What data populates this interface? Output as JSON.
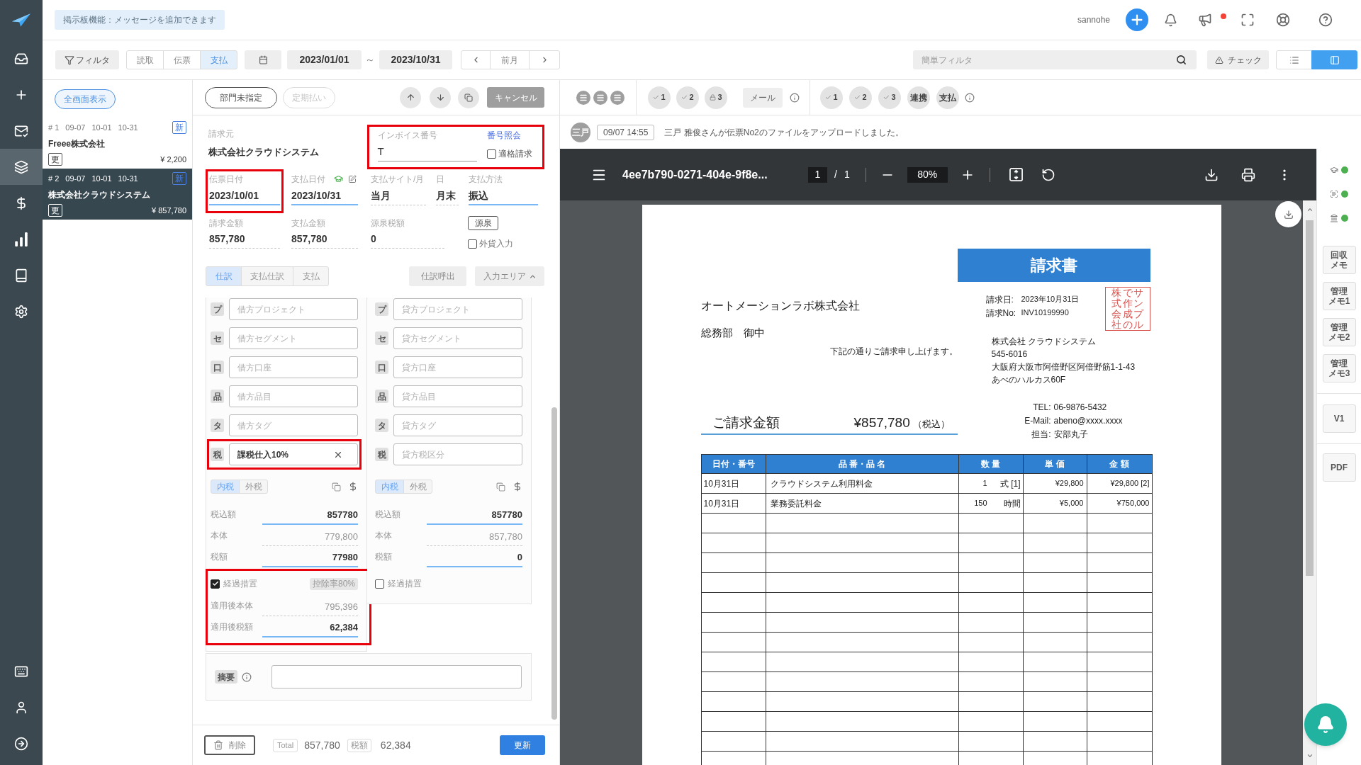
{
  "nav": {
    "items": [
      {
        "kind": "inbox",
        "selected": false
      },
      {
        "kind": "add",
        "selected": false
      },
      {
        "kind": "mail",
        "selected": false
      },
      {
        "kind": "layers",
        "selected": true
      },
      {
        "kind": "dollar",
        "selected": false
      },
      {
        "kind": "chart",
        "selected": false
      },
      {
        "kind": "book",
        "selected": false
      },
      {
        "kind": "settings",
        "selected": false
      }
    ],
    "bottom_items": [
      {
        "kind": "keyboard",
        "selected": false
      },
      {
        "kind": "user",
        "selected": false
      },
      {
        "kind": "logout",
        "selected": false
      }
    ]
  },
  "header": {
    "bulletin": "掲示板機能：メッセージを追加できます",
    "user": "sannohe",
    "announcements_unread": true
  },
  "filter_bar": {
    "filter_label": "フィルタ",
    "modes": [
      {
        "label": "読取",
        "selected": false
      },
      {
        "label": "伝票",
        "selected": false
      },
      {
        "label": "支払",
        "selected": true
      }
    ],
    "date_from": "2023/01/01",
    "range_separator": "～",
    "date_to": "2023/10/31",
    "prev_month": "前月",
    "search": {
      "placeholder": "簡単フィルタ"
    },
    "check_label": "チェック",
    "views": [
      {
        "kind": "list",
        "selected": false
      },
      {
        "kind": "split",
        "selected": true
      }
    ]
  },
  "list": {
    "fullscreen_label": "全画面表示",
    "items": [
      {
        "number": "# 1",
        "dates": [
          "09-07",
          "10-01",
          "10-31"
        ],
        "new_badge": "新",
        "vendor": "Freee株式会社",
        "update_badge": "更",
        "amount": "¥ 2,200",
        "selected": false
      },
      {
        "number": "# 2",
        "dates": [
          "09-07",
          "10-01",
          "10-31"
        ],
        "new_badge": "新",
        "vendor": "株式会社クラウドシステム",
        "update_badge": "更",
        "amount": "¥ 857,780",
        "selected": true
      }
    ]
  },
  "form": {
    "toolbar": {
      "department": "部門未指定",
      "recurring": {
        "label": "定期払い",
        "disabled": true
      },
      "cancel": "キャンセル"
    },
    "vendor": {
      "label": "請求元",
      "value": "株式会社クラウドシステム"
    },
    "invoice": {
      "label": "インボイス番号",
      "value": "T",
      "lookup": "番号照会",
      "qualified": {
        "label": "適格請求",
        "checked": false
      },
      "highlighted": true
    },
    "dates": [
      {
        "label": "伝票日付",
        "value": "2023/10/01",
        "kind": "input",
        "highlighted": true
      },
      {
        "label": "支払日付",
        "value": "2023/10/31",
        "kind": "input",
        "highlighted": false,
        "tools": true
      },
      {
        "label": "支払サイト/月",
        "value": "当月",
        "kind": "readonly",
        "highlighted": false
      },
      {
        "label": "日",
        "value": "月末",
        "kind": "readonly",
        "highlighted": false
      },
      {
        "label": "支払方法",
        "value": "振込",
        "kind": "input",
        "highlighted": false
      }
    ],
    "amounts": [
      {
        "label": "請求金額",
        "value": "857,780",
        "kind": "readonly"
      },
      {
        "label": "支払金額",
        "value": "857,780",
        "kind": "readonly"
      },
      {
        "label": "源泉税額",
        "value": "0",
        "kind": "readonly"
      }
    ],
    "withholding_button": "源泉",
    "foreign_currency": {
      "label": "外貨入力",
      "checked": false
    },
    "tabs": [
      {
        "label": "仕訳",
        "selected": true
      },
      {
        "label": "支払仕訳",
        "selected": false
      },
      {
        "label": "支払",
        "selected": false
      }
    ],
    "recall": "仕訳呼出",
    "input_area": "入力エリア",
    "columns": [
      {
        "fields": [
          {
            "tag": "プ",
            "placeholder": "借方プロジェクト",
            "highlighted": false
          },
          {
            "tag": "セ",
            "placeholder": "借方セグメント",
            "highlighted": false
          },
          {
            "tag": "口",
            "placeholder": "借方口座",
            "highlighted": false
          },
          {
            "tag": "品",
            "placeholder": "借方品目",
            "highlighted": false
          },
          {
            "tag": "タ",
            "placeholder": "借方タグ",
            "highlighted": false
          },
          {
            "tag": "税",
            "value": "課税仕入10%",
            "highlighted": true
          }
        ],
        "tax_modes": [
          {
            "label": "内税",
            "selected": true
          },
          {
            "label": "外税",
            "selected": false
          }
        ],
        "amounts": [
          {
            "label": "税込額",
            "value": "857780",
            "kind": "input"
          },
          {
            "label": "本体",
            "value": "779,800",
            "kind": "readonly"
          },
          {
            "label": "税額",
            "value": "77980",
            "kind": "input"
          }
        ],
        "transition": {
          "label": "経過措置",
          "checked": true,
          "rate": "控除率80%",
          "rows": [
            {
              "label": "適用後本体",
              "value": "795,396",
              "kind": "readonly"
            },
            {
              "label": "適用後税額",
              "value": "62,384",
              "kind": "input"
            }
          ],
          "highlighted": true
        }
      },
      {
        "fields": [
          {
            "tag": "プ",
            "placeholder": "貸方プロジェクト",
            "highlighted": false
          },
          {
            "tag": "セ",
            "placeholder": "貸方セグメント",
            "highlighted": false
          },
          {
            "tag": "口",
            "placeholder": "貸方口座",
            "highlighted": false
          },
          {
            "tag": "品",
            "placeholder": "貸方品目",
            "highlighted": false
          },
          {
            "tag": "タ",
            "placeholder": "貸方タグ",
            "highlighted": false
          },
          {
            "tag": "税",
            "placeholder": "貸方税区分",
            "highlighted": false
          }
        ],
        "tax_modes": [
          {
            "label": "内税",
            "selected": true
          },
          {
            "label": "外税",
            "selected": false
          }
        ],
        "amounts": [
          {
            "label": "税込額",
            "value": "857780",
            "kind": "input"
          },
          {
            "label": "本体",
            "value": "857,780",
            "kind": "readonly"
          },
          {
            "label": "税額",
            "value": "0",
            "kind": "input"
          }
        ],
        "transition": {
          "label": "経過措置",
          "checked": false,
          "highlighted": false
        }
      }
    ],
    "memo": {
      "tag": "摘要"
    },
    "footer": {
      "delete": "削除",
      "total_label": "Total",
      "total": "857,780",
      "tax_label": "税額",
      "tax": "62,384",
      "update": "更新"
    }
  },
  "toolbar": {
    "approvals": [
      {
        "kind": "check",
        "label": "1"
      },
      {
        "kind": "check",
        "label": "2"
      },
      {
        "kind": "lock",
        "label": "3"
      }
    ],
    "mail": "メール",
    "stages": [
      {
        "kind": "check",
        "label": "1"
      },
      {
        "kind": "check",
        "label": "2"
      },
      {
        "kind": "check",
        "label": "3"
      },
      {
        "kind": "text",
        "label": "連携"
      },
      {
        "kind": "text",
        "label": "支払"
      }
    ]
  },
  "activity": {
    "avatar": "三戸",
    "time": "09/07 14:55",
    "message": "三戸 雅俊さんが伝票No2のファイルをアップロードしました。"
  },
  "viewer": {
    "filename": "4ee7b790-0271-404e-9f8e...",
    "page": "1",
    "page_separator": "/",
    "page_count": "1",
    "zoom": "80%"
  },
  "document": {
    "title": "請求書",
    "recipient": "オートメーションラボ株式会社",
    "department": "総務部　御中",
    "note": "下記の通りご請求申し上げます。",
    "meta": [
      {
        "label": "請求日:",
        "value": "2023年10月31日"
      },
      {
        "label": "請求No:",
        "value": "INV10199990"
      }
    ],
    "stamp": [
      "株式会社",
      "で作成の",
      "サンプル"
    ],
    "issuer": [
      "株式会社 クラウドシステム",
      "545-6016",
      "大阪府大阪市阿倍野区阿倍野筋1-1-43",
      "あべのハルカス60F"
    ],
    "contact": [
      {
        "label": "TEL:",
        "value": "06-9876-5432"
      },
      {
        "label": "E-Mail:",
        "value": "abeno@xxxx.xxxx"
      },
      {
        "label": "担当:",
        "value": "安部丸子"
      }
    ],
    "total_label": "ご請求金額",
    "total": "¥857,780",
    "total_note": "（税込）",
    "table": {
      "columns": [
        "日付・番号",
        "品 番・品 名",
        "数 量",
        "単 価",
        "金 額"
      ],
      "rows": [
        {
          "date": "10月31日",
          "item": "クラウドシステム利用料金",
          "quantity": "1",
          "unit": "式 [1]",
          "price": "¥29,800",
          "amount": "¥29,800 [2]"
        },
        {
          "date": "10月31日",
          "item": "業務委託料金",
          "quantity": "150",
          "unit": "時間",
          "price": "¥5,000",
          "amount": "¥750,000"
        }
      ]
    }
  },
  "side_panel": {
    "status": [
      {
        "kind": "cap",
        "color": "#4caf50"
      },
      {
        "kind": "scan",
        "color": "#4caf50"
      },
      {
        "kind": "bank",
        "color": "#4caf50"
      }
    ],
    "memos": [
      "回収メモ",
      "管理メモ1",
      "管理メモ2",
      "管理メモ3"
    ],
    "version": "V1",
    "pdf": "PDF"
  }
}
